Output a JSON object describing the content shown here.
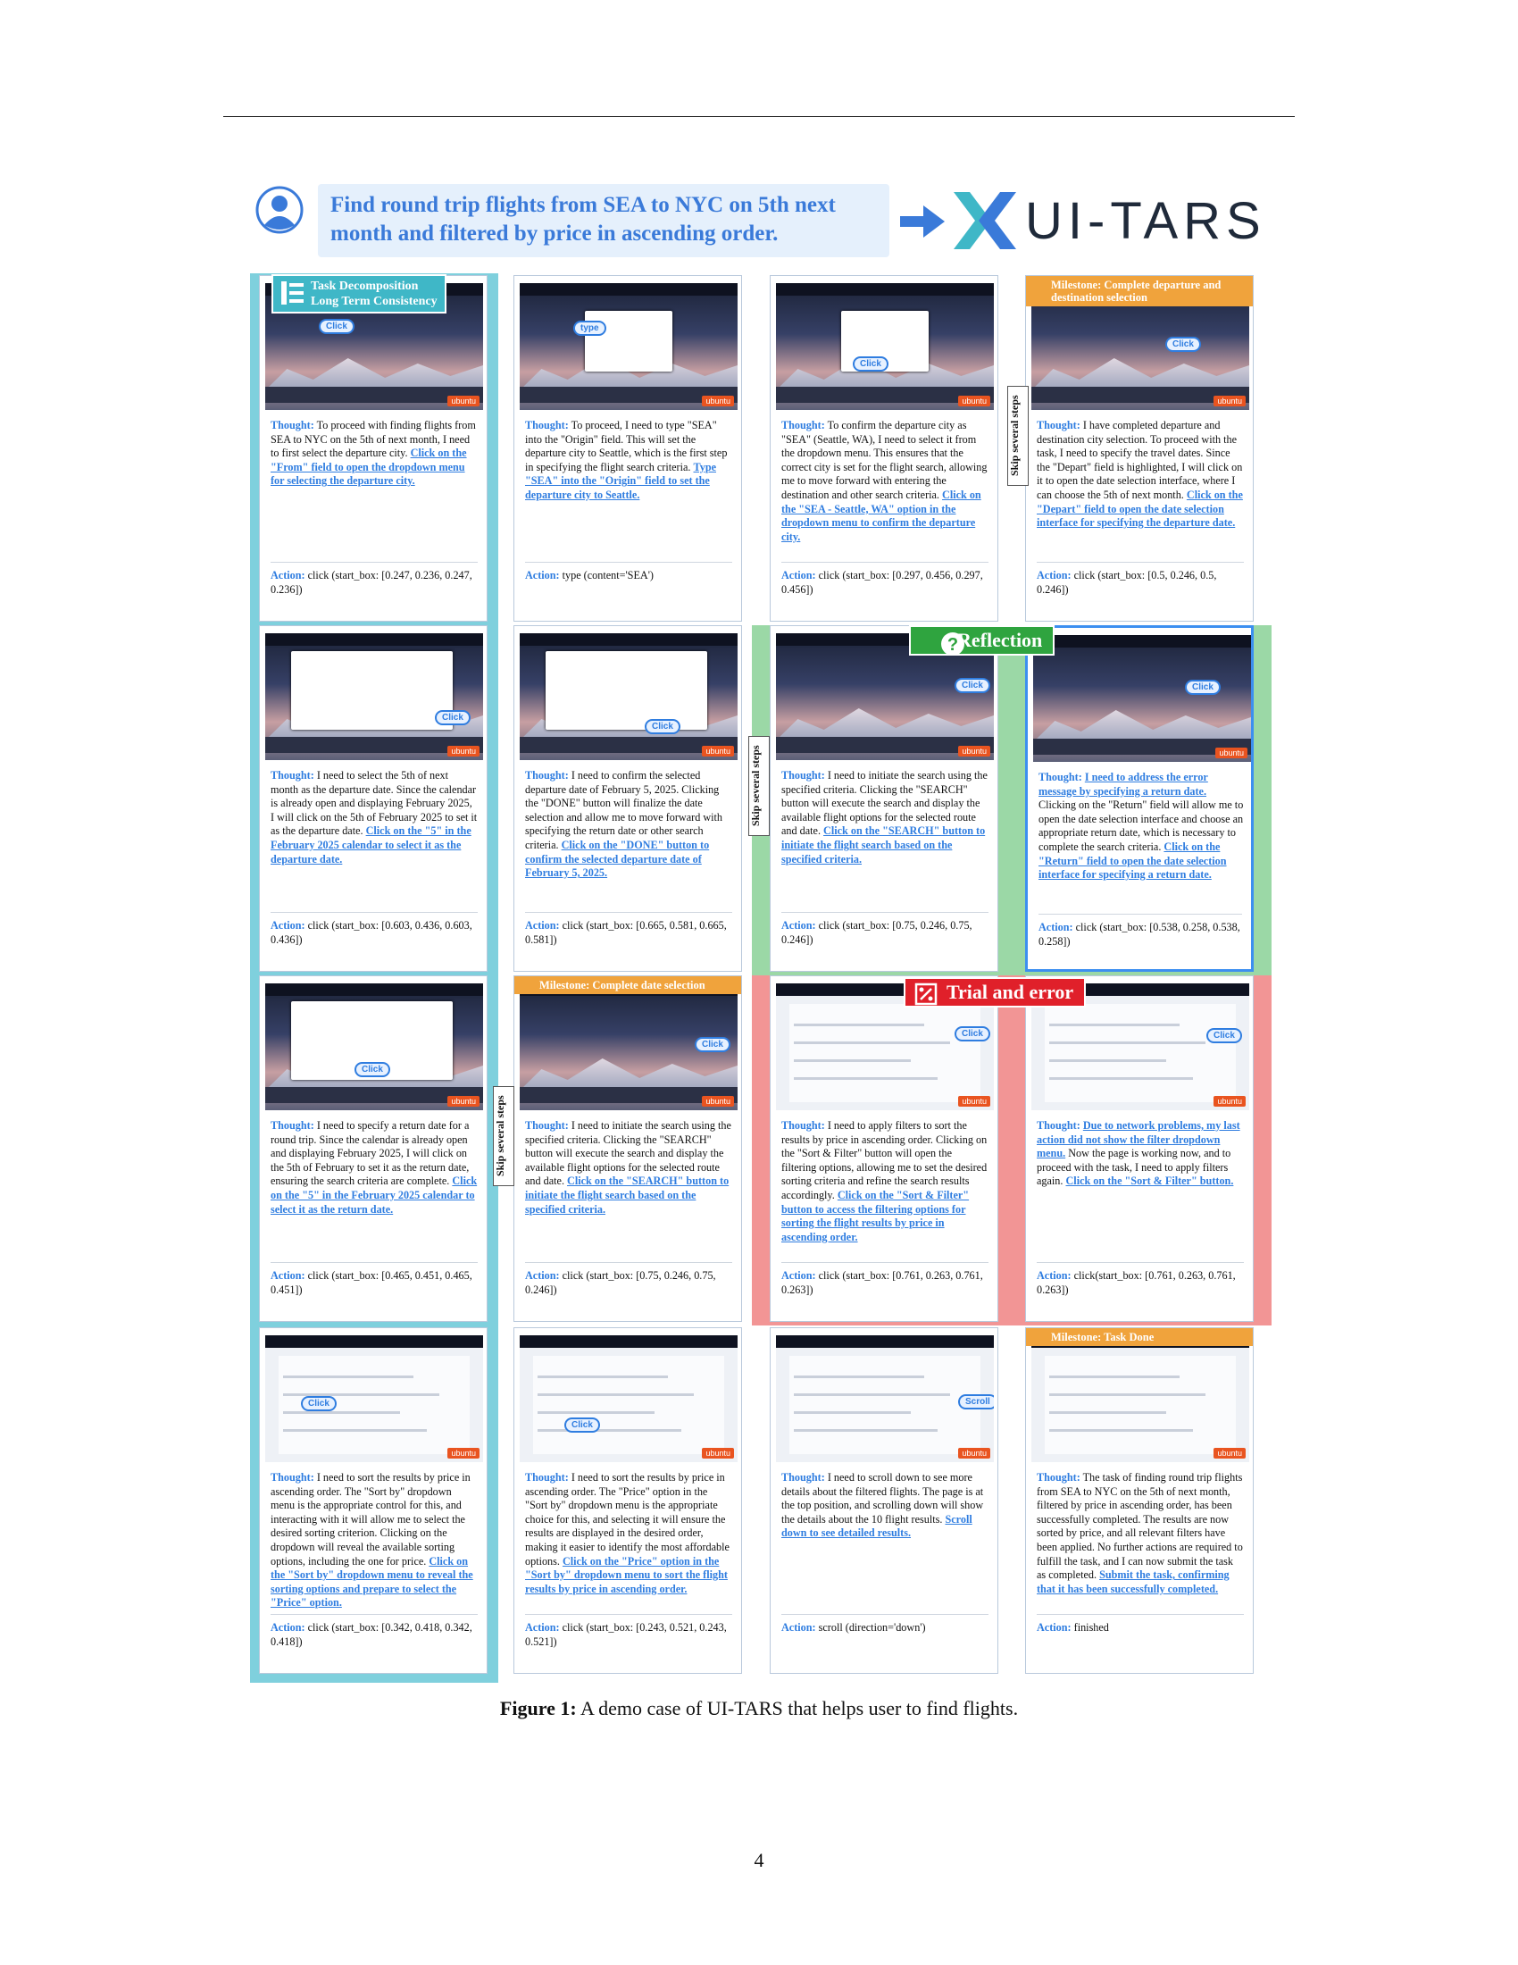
{
  "task": "Find round trip flights from SEA to NYC on 5th next month and filtered by price in ascending order.",
  "brand": "UI-TARS",
  "labels": {
    "task_decomposition": "Task Decomposition",
    "long_term": "Long Term Consistency",
    "reflection": "Reflection",
    "trial_error": "Trial and error",
    "skip": "Skip several steps",
    "thought": "Thought:",
    "action": "Action:",
    "click": "Click",
    "type": "type",
    "scroll": "Scroll",
    "ubuntu": "ubuntu"
  },
  "cards": [
    {
      "milestone": "",
      "text": "To proceed with finding flights from SEA to NYC on the 5th of next month, I need to first select the departure city.",
      "link": "Click on the \"From\" field to open the dropdown menu for selecting the departure city.",
      "action": "click (start_box: [0.247, 0.236, 0.247, 0.236])",
      "bubble": "click"
    },
    {
      "milestone": "",
      "text": "To proceed, I need to type \"SEA\" into the \"Origin\" field. This will set the departure city to Seattle, which is the first step in specifying the flight search criteria.",
      "link": "Type \"SEA\" into the \"Origin\" field to set the departure city to Seattle.",
      "action": "type (content='SEA')",
      "bubble": "type"
    },
    {
      "milestone": "",
      "text": "To confirm the departure city as \"SEA\" (Seattle, WA), I need to select it from the dropdown menu. This ensures that the correct city is set for the flight search, allowing me to move forward with entering the destination and other search criteria.",
      "link": "Click on the \"SEA - Seattle, WA\" option in the dropdown menu to confirm the departure city.",
      "action": "click (start_box: [0.297, 0.456, 0.297, 0.456])",
      "bubble": "click"
    },
    {
      "milestone": "Milestone: Complete departure and destination selection",
      "text": "I have completed departure and destination city selection. To proceed with the task, I need to specify the travel dates. Since the \"Depart\" field is highlighted, I will click on it to open the date selection interface, where I can choose the 5th of next month.",
      "link": "Click on the \"Depart\" field to open the date selection interface for specifying the departure date.",
      "action": "click (start_box: [0.5, 0.246, 0.5, 0.246])",
      "bubble": "click"
    },
    {
      "milestone": "",
      "text": "I need to select the 5th of next month as the departure date. Since the calendar is already open and displaying February 2025, I will click on the 5th of February 2025 to set it as the departure date.",
      "link": "Click on the \"5\" in the February 2025 calendar to select it as the departure date.",
      "action": "click (start_box: [0.603, 0.436, 0.603, 0.436])",
      "bubble": "click"
    },
    {
      "milestone": "",
      "text": "I need to confirm the selected departure date of February 5, 2025. Clicking the \"DONE\" button will finalize the date selection and allow me to move forward with specifying the return date or other search criteria.",
      "link": "Click on the \"DONE\" button to confirm the selected departure date of February 5, 2025.",
      "action": "click (start_box: [0.665, 0.581, 0.665, 0.581])",
      "bubble": "click"
    },
    {
      "milestone": "",
      "text": "I need to initiate the search using the specified criteria. Clicking the \"SEARCH\" button will execute the search and display the available flight options for the selected route and date.",
      "link": "Click on the \"SEARCH\" button to initiate the flight search based on the specified criteria.",
      "action": "click (start_box: [0.75, 0.246, 0.75, 0.246])",
      "bubble": "click"
    },
    {
      "milestone": "",
      "text": "",
      "lead_link": "I need to address the error message by specifying a return date.",
      "text2": "Clicking on the \"Return\" field will allow me to open the date selection interface and choose an appropriate return date, which is necessary to complete the search criteria.",
      "link": "Click on the \"Return\" field to open the date selection interface for specifying a return date.",
      "action": "click (start_box: [0.538, 0.258, 0.538, 0.258])",
      "bubble": "click"
    },
    {
      "milestone": "",
      "text": "I need to specify a return date for a round trip. Since the calendar is already open and displaying February 2025, I will click on the 5th of February to set it as the return date, ensuring the search criteria are complete.",
      "link": "Click on the \"5\" in the February 2025 calendar to select it as the return date.",
      "action": "click (start_box: [0.465, 0.451, 0.465, 0.451])",
      "bubble": "click"
    },
    {
      "milestone": "Milestone: Complete date selection",
      "text": "I need to initiate the search using the specified criteria. Clicking the \"SEARCH\" button will execute the search and display the available flight options for the selected route and date.",
      "link": "Click on the \"SEARCH\" button to initiate the flight search based on the specified criteria.",
      "action": "click (start_box: [0.75, 0.246, 0.75, 0.246])",
      "bubble": "click"
    },
    {
      "milestone": "",
      "text": "I need to apply filters to sort the results by price in ascending order. Clicking on the \"Sort & Filter\" button will open the filtering options, allowing me to set the desired sorting criteria and refine the search results accordingly.",
      "link": "Click on the \"Sort & Filter\" button to access the filtering options for sorting the flight results by price in ascending order.",
      "action": "click (start_box: [0.761, 0.263, 0.761, 0.263])",
      "bubble": "click"
    },
    {
      "milestone": "",
      "text": "",
      "lead_link": "Due to network problems, my last action did not show the filter dropdown menu.",
      "text2": "Now the page is working now, and to proceed with the task, I need to apply filters again.",
      "link": "Click on the \"Sort & Filter\" button.",
      "action": "click(start_box: [0.761, 0.263, 0.761, 0.263])",
      "bubble": "click"
    },
    {
      "milestone": "",
      "text": "I need to sort the results by price in ascending order. The \"Sort by\" dropdown menu is the appropriate control for this, and interacting with it will allow me to select the desired sorting criterion. Clicking on the dropdown will reveal the available sorting options, including the one for price.",
      "link": "Click on the \"Sort by\" dropdown menu to reveal the sorting options and prepare to select the \"Price\" option.",
      "action": "click (start_box: [0.342, 0.418, 0.342, 0.418])",
      "bubble": "click"
    },
    {
      "milestone": "",
      "text": "I need to sort the results by price in ascending order. The \"Price\" option in the \"Sort by\" dropdown menu is the appropriate choice for this, and selecting it will ensure the results are displayed in the desired order, making it easier to identify the most affordable options.",
      "link": "Click on the \"Price\" option in the \"Sort by\" dropdown menu to sort the flight results by price in ascending order.",
      "action": "click (start_box: [0.243, 0.521, 0.243, 0.521])",
      "bubble": "click"
    },
    {
      "milestone": "",
      "text": "I need to scroll down to see more details about the filtered flights. The page is at the top position, and scrolling down will show the details about the 10 flight results.",
      "link": "Scroll down to see detailed results.",
      "action": "scroll (direction='down')",
      "bubble": "scroll"
    },
    {
      "milestone": "Milestone: Task Done",
      "text": "The task of finding round trip flights from SEA to NYC on the 5th of next month, filtered by price in ascending order, has been successfully completed. The results are now sorted by price, and all relevant filters have been applied. No further actions are required to fulfill the task, and I can now submit the task as completed.",
      "link": "Submit the task, confirming that it has been successfully completed.",
      "action": "finished",
      "bubble": ""
    }
  ],
  "caption_label": "Figure 1:",
  "caption_text": "A demo case of UI-TARS that helps user to find flights.",
  "page_number": "4"
}
